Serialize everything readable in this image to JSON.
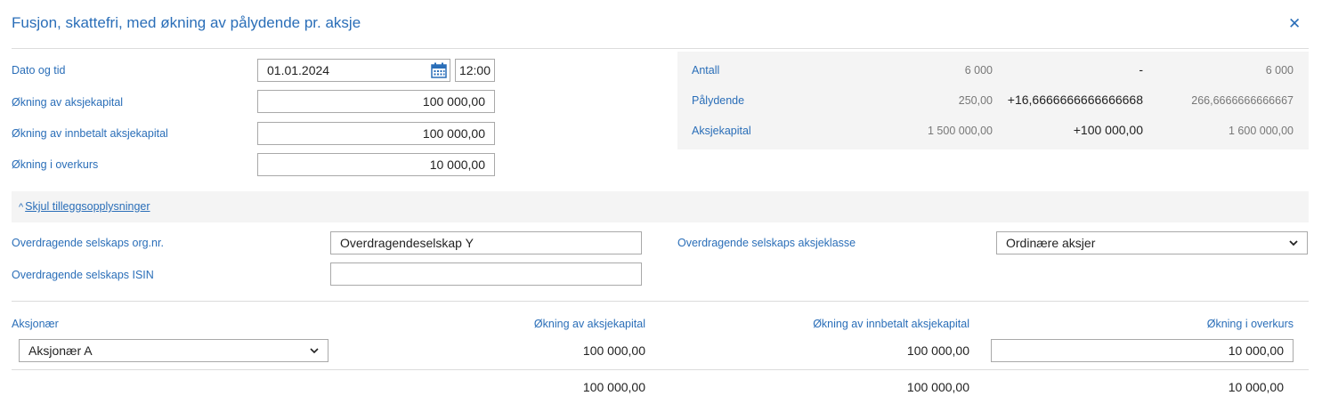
{
  "dialog": {
    "title": "Fusjon, skattefri, med økning av pålydende pr. aksje",
    "close_icon": "close-icon"
  },
  "form": {
    "date_label": "Dato og tid",
    "date_value": "01.01.2024",
    "time_value": "12:00",
    "capital_increase_label": "Økning av aksjekapital",
    "capital_increase_value": "100 000,00",
    "paid_capital_increase_label": "Økning av innbetalt aksjekapital",
    "paid_capital_increase_value": "100 000,00",
    "premium_increase_label": "Økning i overkurs",
    "premium_increase_value": "10 000,00"
  },
  "summary": {
    "rows": [
      {
        "label": "Antall",
        "before": "6 000",
        "change": "-",
        "after": "6 000"
      },
      {
        "label": "Pålydende",
        "before": "250,00",
        "change": "+16,6666666666666668",
        "after": "266,6666666666667"
      },
      {
        "label": "Aksjekapital",
        "before": "1 500 000,00",
        "change": "+100 000,00",
        "after": "1 600 000,00"
      }
    ]
  },
  "extra": {
    "toggle_label": "Skjul tilleggsopplysninger",
    "org_nr_label": "Overdragende selskaps org.nr.",
    "org_nr_value": "Overdragendeselskap Y",
    "isin_label": "Overdragende selskaps ISIN",
    "isin_value": "",
    "share_class_label": "Overdragende selskaps aksjeklasse",
    "share_class_value": "Ordinære aksjer"
  },
  "shareholders": {
    "headers": {
      "shareholder": "Aksjonær",
      "capital_increase": "Økning av aksjekapital",
      "paid_capital_increase": "Økning av innbetalt aksjekapital",
      "premium_increase": "Økning i overkurs"
    },
    "rows": [
      {
        "shareholder": "Aksjonær A",
        "capital_increase": "100 000,00",
        "paid_capital_increase": "100 000,00",
        "premium_increase": "10 000,00"
      }
    ],
    "totals": {
      "capital_increase": "100 000,00",
      "paid_capital_increase": "100 000,00",
      "premium_increase": "10 000,00"
    }
  }
}
